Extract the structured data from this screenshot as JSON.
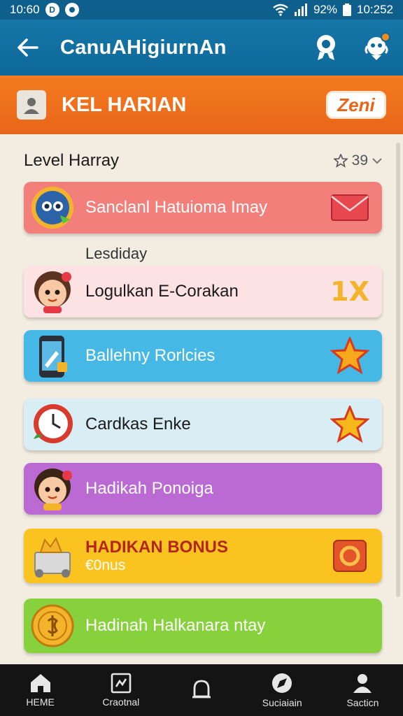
{
  "status_bar": {
    "time_left": "10:60",
    "battery": "92%",
    "time_right": "10:252"
  },
  "app_bar": {
    "title": "CanuAHigiurnAn"
  },
  "banner": {
    "title": "KEL HARIAN",
    "badge": "Zeni"
  },
  "section": {
    "title": "Level Harray",
    "meta_count": "39"
  },
  "cards": [
    {
      "label": "Sanclanl Hatuioma Imay",
      "bg": "#f37f7a",
      "text_color": "light"
    },
    {
      "label": "Logulkan E-Corakan",
      "bg": "#fde2e4",
      "text_color": "dark",
      "trail_text": "1X"
    },
    {
      "label": "Ballehny Rorlcies",
      "bg": "#45b8e6",
      "text_color": "light"
    },
    {
      "label": "Cardkas Enke",
      "bg": "#d9edf4",
      "text_color": "dark"
    },
    {
      "label": "Hadikah Ponoiga",
      "bg": "#ba6ad2",
      "text_color": "light"
    },
    {
      "label": "HADIKAN BONUS",
      "sub": "€0nus",
      "bg": "#fbc320",
      "text_color": "bonus"
    },
    {
      "label": "Hadinah Halkanara ntay",
      "bg": "#86d13c",
      "text_color": "light"
    }
  ],
  "sub_label": "Lesdiday",
  "bottom_nav": [
    {
      "label": "HEME",
      "icon": "home-icon"
    },
    {
      "label": "Craotnal",
      "icon": "chart-icon"
    },
    {
      "label": "",
      "icon": "bell-icon"
    },
    {
      "label": "Suciaiain",
      "icon": "compass-icon"
    },
    {
      "label": "Sacticn",
      "icon": "profile-icon"
    }
  ]
}
